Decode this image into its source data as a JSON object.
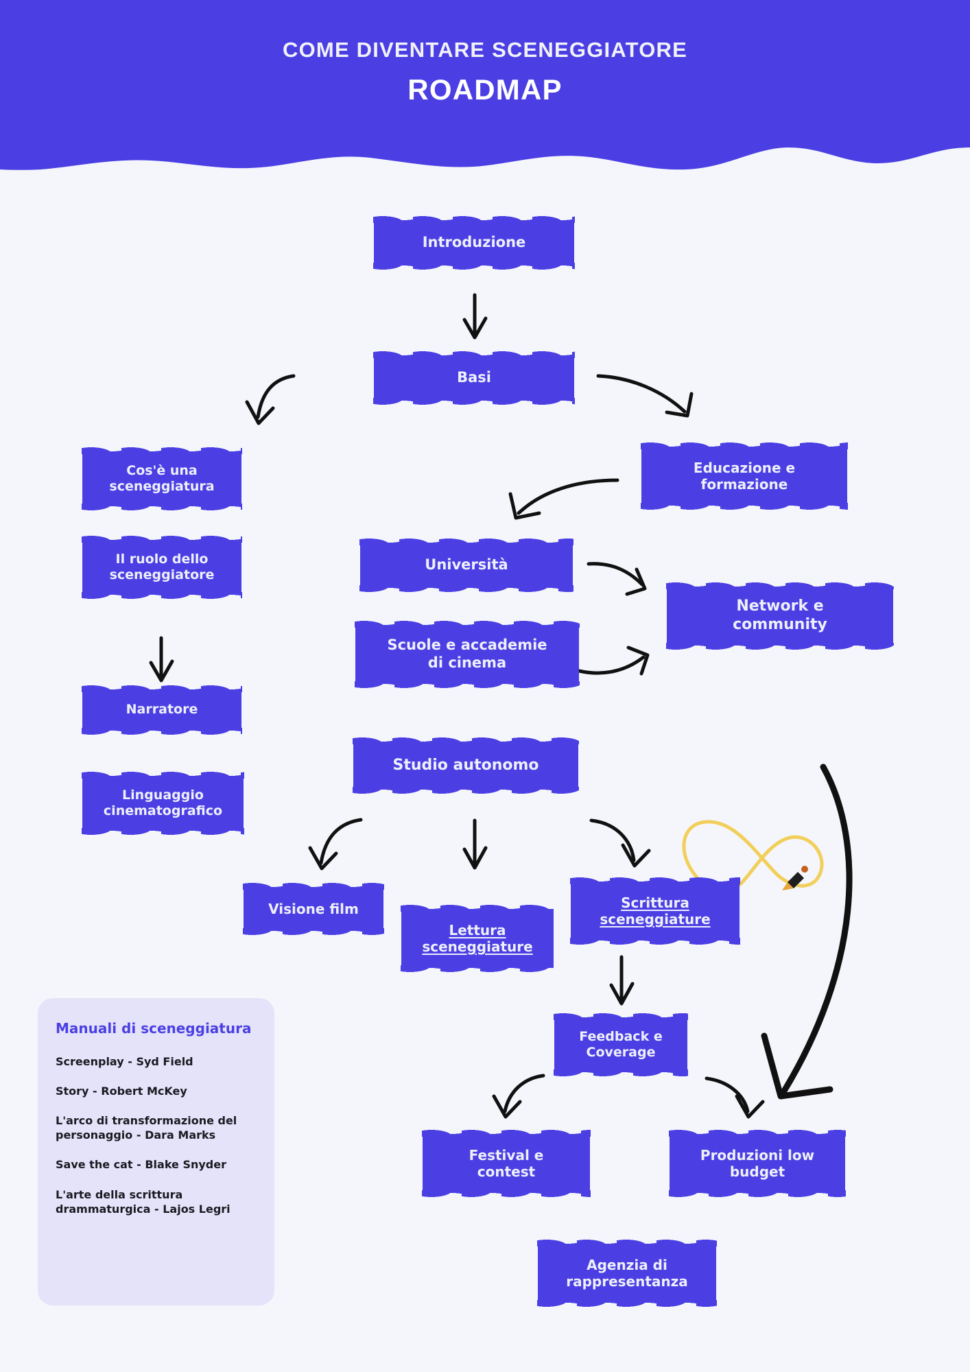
{
  "header": {
    "subtitle": "COME DIVENTARE SCENEGGIATORE",
    "title": "ROADMAP",
    "band_color": "#4b3fe4",
    "text_color": "#ffffff"
  },
  "page": {
    "background_color": "#f4f6fb",
    "node_color": "#4b3fe4",
    "node_text_color": "#eef0fb",
    "accent_color": "#4b3fe4",
    "doodle_color": "#111111",
    "infinity_color": "#f2cf5a"
  },
  "nodes": [
    {
      "id": "introduzione",
      "label": "Introduzione"
    },
    {
      "id": "basi",
      "label": "Basi"
    },
    {
      "id": "cose-una-sceneggiatura",
      "label": "Cos'è una\nsceneggiatura"
    },
    {
      "id": "educazione-formazione",
      "label": "Educazione e\nformazione"
    },
    {
      "id": "ruolo-sceneggiatore",
      "label": "Il ruolo dello\nsceneggiatore"
    },
    {
      "id": "universita",
      "label": "Università"
    },
    {
      "id": "network-community",
      "label": "Network e\ncommunity"
    },
    {
      "id": "scuole-accademie",
      "label": "Scuole e accademie\ndi cinema"
    },
    {
      "id": "narratore",
      "label": "Narratore"
    },
    {
      "id": "studio-autonomo",
      "label": "Studio autonomo"
    },
    {
      "id": "linguaggio-cinematografico",
      "label": "Linguaggio\ncinematografico"
    },
    {
      "id": "visione-film",
      "label": "Visione film"
    },
    {
      "id": "lettura-sceneggiature",
      "label": "Lettura\nsceneggiature",
      "underlined": true
    },
    {
      "id": "scrittura-sceneggiature",
      "label": "Scrittura\nsceneggiature",
      "underlined": true
    },
    {
      "id": "feedback-coverage",
      "label": "Feedback e\nCoverage"
    },
    {
      "id": "festival-contest",
      "label": "Festival e\ncontest"
    },
    {
      "id": "produzioni-low-budget",
      "label": "Produzioni low\nbudget"
    },
    {
      "id": "agenzia-rappresentanza",
      "label": "Agenzia di\nrappresentanza"
    }
  ],
  "legend": {
    "title": "Manuali di sceneggiatura",
    "items": [
      "Screenplay - Syd Field",
      "Story - Robert McKey",
      "L'arco di transformazione del personaggio - Dara Marks",
      "Save the cat - Blake Snyder",
      "L'arte della scrittura drammaturgica - Lajos Legri"
    ]
  },
  "connections": [
    {
      "from": "introduzione",
      "to": "basi",
      "style": "straight-arrow"
    },
    {
      "from": "basi",
      "to": "cose-una-sceneggiatura",
      "style": "curved-arrow-left"
    },
    {
      "from": "basi",
      "to": "educazione-formazione",
      "style": "curved-arrow-right"
    },
    {
      "from": "educazione-formazione",
      "to": "universita",
      "style": "curved-arrow-left"
    },
    {
      "from": "ruolo-sceneggiatore",
      "to": "narratore",
      "style": "straight-arrow"
    },
    {
      "from": "universita",
      "to": "network-community",
      "style": "curved-arrow-right"
    },
    {
      "from": "scuole-accademie",
      "to": "network-community",
      "style": "curved-arrow-right"
    },
    {
      "from": "studio-autonomo",
      "to": "visione-film",
      "style": "curved-arrow-left"
    },
    {
      "from": "studio-autonomo",
      "to": "lettura-sceneggiature",
      "style": "straight-arrow"
    },
    {
      "from": "studio-autonomo",
      "to": "scrittura-sceneggiature",
      "style": "curved-arrow-right"
    },
    {
      "from": "scrittura-sceneggiature",
      "to": "feedback-coverage",
      "style": "straight-arrow"
    },
    {
      "from": "feedback-coverage",
      "to": "festival-contest",
      "style": "curved-arrow-left"
    },
    {
      "from": "feedback-coverage",
      "to": "produzioni-low-budget",
      "style": "curved-arrow-right"
    },
    {
      "from": "scrittura-sceneggiature",
      "to": "produzioni-low-budget",
      "style": "long-curve-right"
    }
  ],
  "decorations": [
    {
      "id": "infinity-loop",
      "name": "infinity-doodle",
      "color": "#f2cf5a"
    },
    {
      "id": "pencil",
      "name": "pencil-icon",
      "color": "#e8a33d"
    }
  ]
}
